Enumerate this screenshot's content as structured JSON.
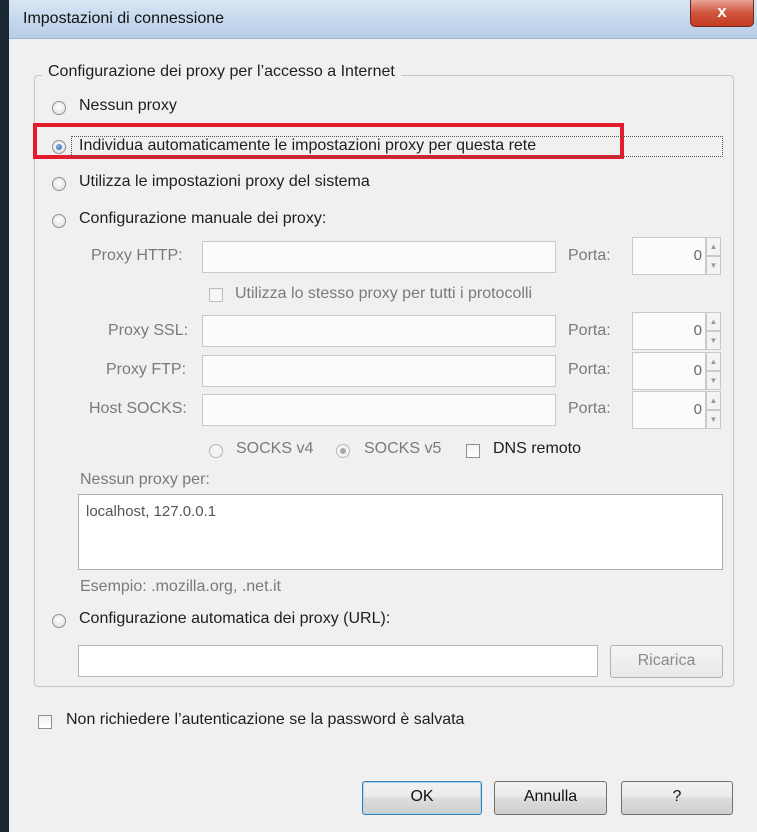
{
  "window": {
    "title": "Impostazioni di connessione",
    "close_symbol": "x"
  },
  "group": {
    "legend": "Configurazione dei proxy per l’accesso a Internet"
  },
  "options": {
    "no_proxy": "Nessun proxy",
    "auto_detect": "Individua automaticamente le impostazioni proxy per questa rete",
    "system": "Utilizza le impostazioni proxy del sistema",
    "manual": "Configurazione manuale dei proxy:",
    "pac": "Configurazione automatica dei proxy (URL):",
    "selected": "auto_detect"
  },
  "manual": {
    "http_label": "Proxy HTTP:",
    "ssl_label": "Proxy SSL:",
    "ftp_label": "Proxy FTP:",
    "socks_label": "Host SOCKS:",
    "port_label": "Porta:",
    "http_port": "0",
    "ssl_port": "0",
    "ftp_port": "0",
    "socks_port": "0",
    "same_proxy": "Utilizza lo stesso proxy per tutti i protocolli",
    "socks_v4": "SOCKS v4",
    "socks_v5": "SOCKS v5",
    "remote_dns": "DNS remoto",
    "no_proxy_for_label": "Nessun proxy per:",
    "no_proxy_for_value": "localhost, 127.0.0.1",
    "example": "Esempio: .mozilla.org, .net.it"
  },
  "pac": {
    "url_value": "",
    "reload_label": "Ricarica"
  },
  "auth": {
    "label": "Non richiedere l’autenticazione se la password è salvata"
  },
  "buttons": {
    "ok": "OK",
    "cancel": "Annulla",
    "help": "?"
  },
  "colors": {
    "highlight": "#e31d2d",
    "radio_selected": "#1f5fb0"
  }
}
